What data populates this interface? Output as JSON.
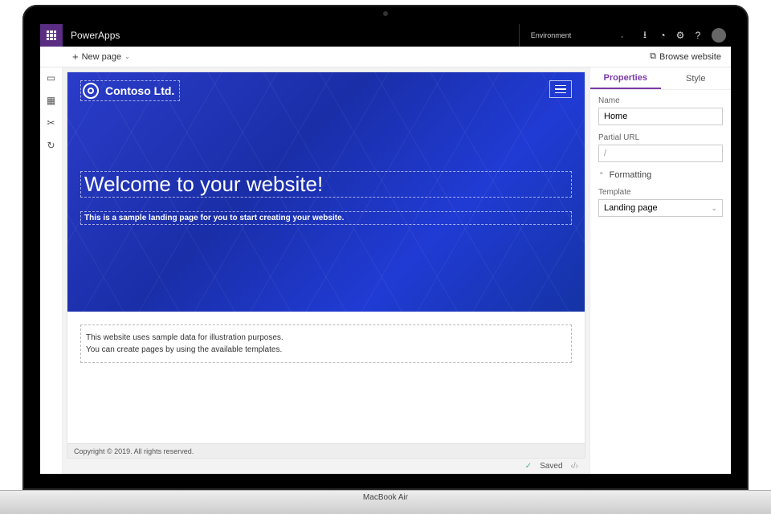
{
  "frame": {
    "device_label": "MacBook Air"
  },
  "header": {
    "app_name": "PowerApps",
    "environment_label": "Environment",
    "icons": {
      "download": "⭳",
      "bell": "◔",
      "gear": "⚙",
      "help": "?"
    }
  },
  "commandbar": {
    "new_page": "New page",
    "browse_website": "Browse website"
  },
  "leftrail": {
    "items": [
      "pages",
      "components",
      "tools",
      "sync"
    ]
  },
  "canvas": {
    "brand": "Contoso Ltd.",
    "headline": "Welcome to your website!",
    "subhead": "This is a sample landing page for you to start creating your website.",
    "body_lines": [
      "This website uses sample data for illustration purposes.",
      "You can create pages by using the available templates."
    ],
    "footer": "Copyright © 2019. All rights reserved."
  },
  "status": {
    "saved": "Saved"
  },
  "properties": {
    "tabs": [
      "Properties",
      "Style"
    ],
    "active_tab": 0,
    "name_label": "Name",
    "name_value": "Home",
    "partial_url_label": "Partial URL",
    "partial_url_value": "/",
    "formatting_section": "Formatting",
    "template_label": "Template",
    "template_value": "Landing page"
  }
}
